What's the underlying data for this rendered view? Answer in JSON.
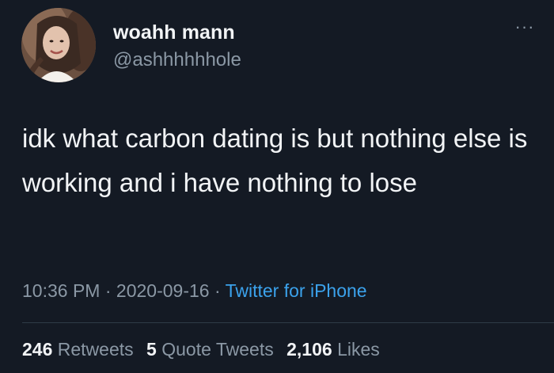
{
  "tweet": {
    "display_name": "woahh mann",
    "handle": "@ashhhhhhole",
    "more_icon": "more-options-icon",
    "text": "idk what carbon dating is but nothing else is working and i have nothing to lose",
    "time": "10:36 PM",
    "date": "2020-09-16",
    "separator": "·",
    "source": "Twitter for iPhone",
    "retweets_count": "246",
    "retweets_label": "Retweets",
    "quote_count": "5",
    "quote_label": "Quote Tweets",
    "likes_count": "2,106",
    "likes_label": "Likes"
  },
  "colors": {
    "background": "#141a24",
    "primary_text": "#f2f4f6",
    "secondary_text": "#8b98a5",
    "link": "#3ba2ec"
  }
}
